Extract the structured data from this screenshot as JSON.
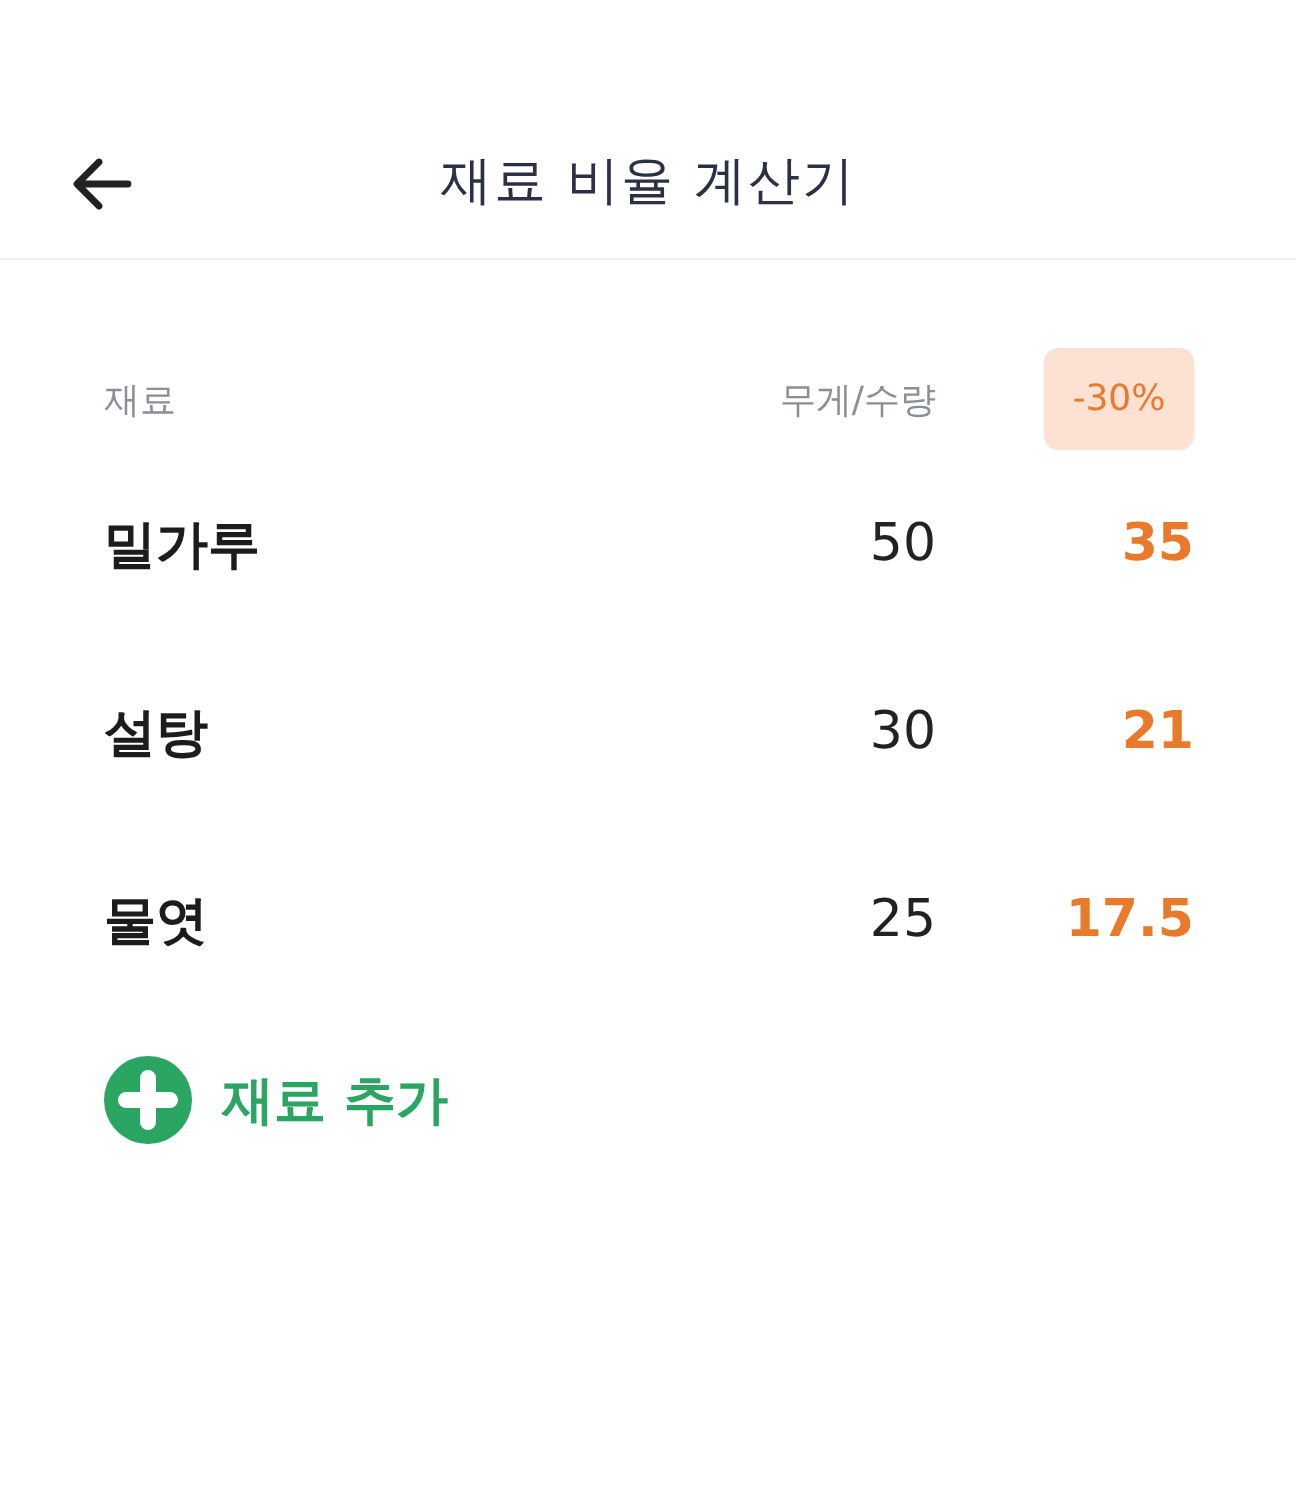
{
  "header": {
    "title": "재료 비율 계산기"
  },
  "table": {
    "columns": {
      "name": "재료",
      "amount": "무게/수량",
      "ratio": "-30%"
    },
    "rows": [
      {
        "name": "밀가루",
        "amount": "50",
        "result": "35"
      },
      {
        "name": "설탕",
        "amount": "30",
        "result": "21"
      },
      {
        "name": "물엿",
        "amount": "25",
        "result": "17.5"
      }
    ]
  },
  "add_button": {
    "label": "재료 추가"
  }
}
